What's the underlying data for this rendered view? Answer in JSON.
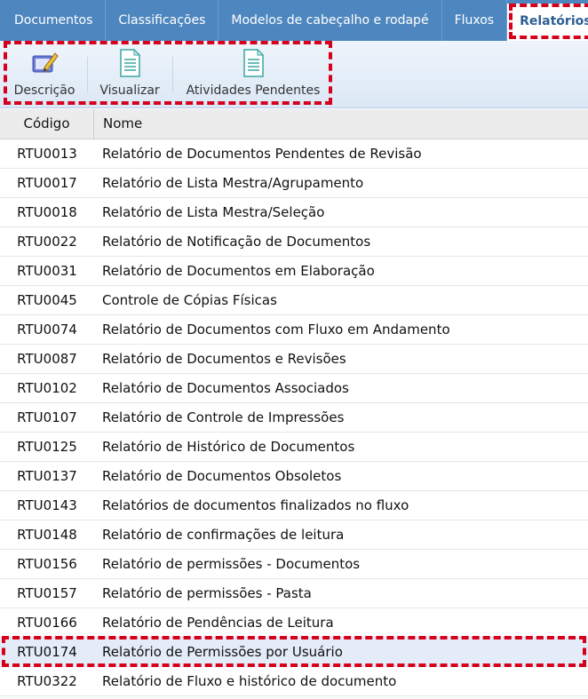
{
  "tabs": [
    {
      "label": "Documentos",
      "active": false
    },
    {
      "label": "Classificações",
      "active": false
    },
    {
      "label": "Modelos de cabeçalho e rodapé",
      "active": false
    },
    {
      "label": "Fluxos",
      "active": false
    },
    {
      "label": "Relatórios",
      "active": true
    }
  ],
  "toolbar": {
    "descricao": {
      "label": "Descrição",
      "icon": "edit-document-icon"
    },
    "visualizar": {
      "label": "Visualizar",
      "icon": "document-icon"
    },
    "pendentes": {
      "label": "Atividades Pendentes",
      "icon": "document-icon"
    }
  },
  "table": {
    "headers": {
      "code": "Código",
      "name": "Nome"
    },
    "rows": [
      {
        "code": "RTU0013",
        "name": "Relatório de Documentos Pendentes de Revisão"
      },
      {
        "code": "RTU0017",
        "name": "Relatório de Lista Mestra/Agrupamento"
      },
      {
        "code": "RTU0018",
        "name": "Relatório de Lista Mestra/Seleção"
      },
      {
        "code": "RTU0022",
        "name": "Relatório de Notificação de Documentos"
      },
      {
        "code": "RTU0031",
        "name": "Relatório de Documentos em Elaboração"
      },
      {
        "code": "RTU0045",
        "name": "Controle de Cópias Físicas"
      },
      {
        "code": "RTU0074",
        "name": "Relatório de Documentos com Fluxo em Andamento"
      },
      {
        "code": "RTU0087",
        "name": "Relatório de Documentos e Revisões"
      },
      {
        "code": "RTU0102",
        "name": "Relatório de Documentos Associados"
      },
      {
        "code": "RTU0107",
        "name": "Relatório de Controle de Impressões"
      },
      {
        "code": "RTU0125",
        "name": "Relatório de Histórico de Documentos"
      },
      {
        "code": "RTU0137",
        "name": "Relatório de Documentos Obsoletos"
      },
      {
        "code": "RTU0143",
        "name": "Relatórios de documentos finalizados no fluxo"
      },
      {
        "code": "RTU0148",
        "name": "Relatório de confirmações de leitura"
      },
      {
        "code": "RTU0156",
        "name": "Relatório de permissões - Documentos"
      },
      {
        "code": "RTU0157",
        "name": "Relatório de permissões - Pasta"
      },
      {
        "code": "RTU0166",
        "name": "Relatório de Pendências de Leitura"
      },
      {
        "code": "RTU0174",
        "name": "Relatório de Permissões por Usuário"
      },
      {
        "code": "RTU0322",
        "name": "Relatório de Fluxo e histórico de documento"
      }
    ],
    "selected_index": 17
  },
  "colors": {
    "tabbar": "#4e87bf",
    "active_tab_text": "#2c5e93",
    "highlight": "#d6001c",
    "selected_row": "#e3ecf8"
  }
}
